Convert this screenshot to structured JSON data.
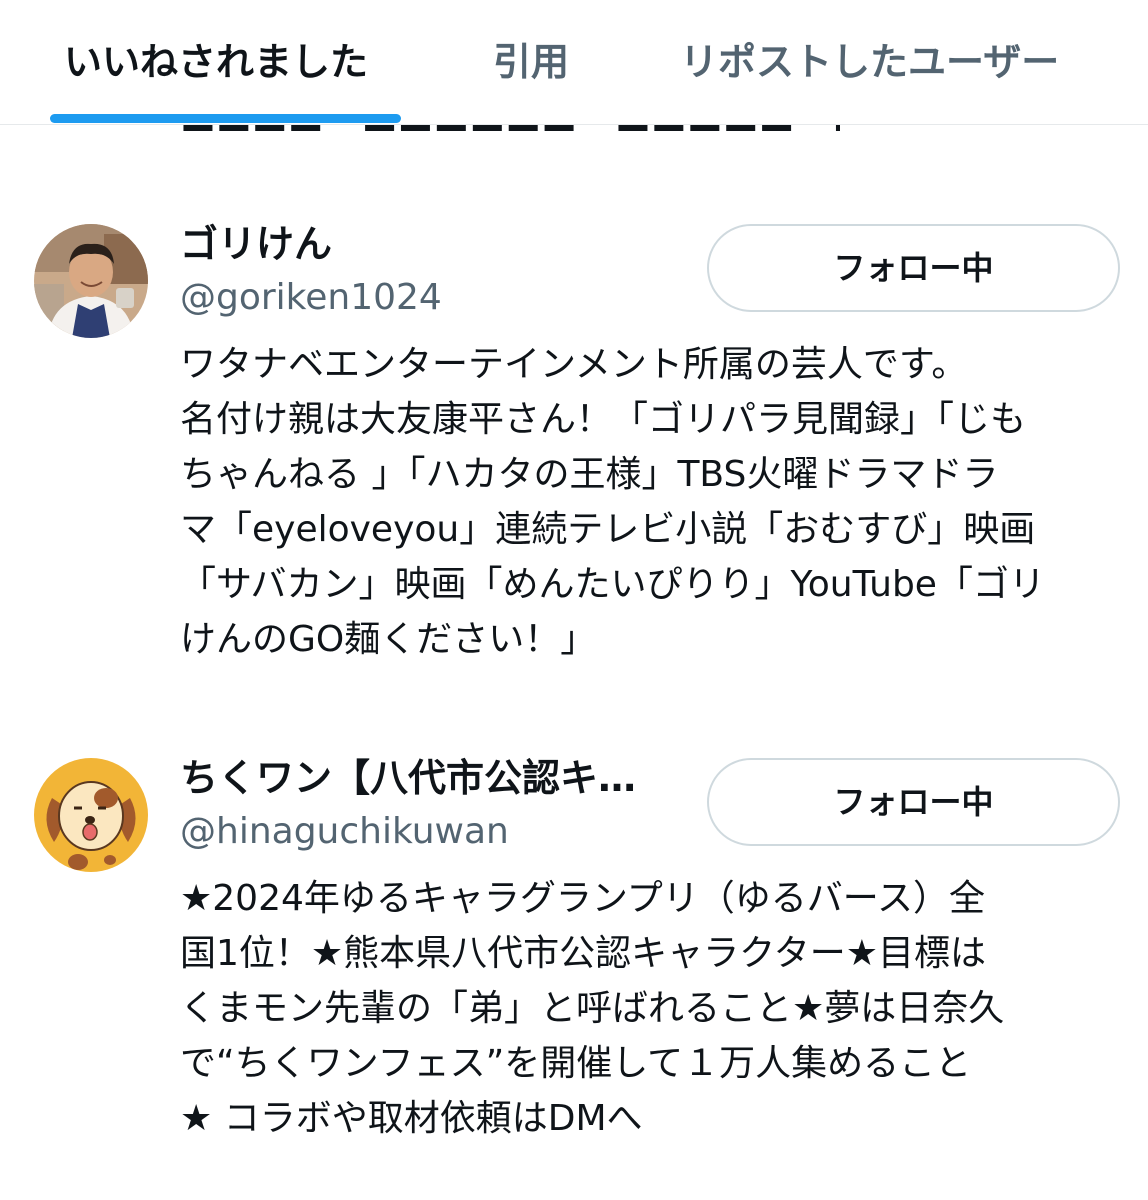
{
  "tabs": {
    "likes": "いいねされました",
    "quotes": "引用",
    "reposts": "リポストしたユーザー"
  },
  "clipped_text": "■■■■　■■■■■■　■■■■■　■",
  "users": [
    {
      "display_name": "ゴリけん",
      "handle": "@goriken1024",
      "follow_label": "フォロー中",
      "bio_lines": [
        "ワタナベエンターテインメント所属の芸人です。",
        "名付け親は大友康平さん！「ゴリパラ見聞録」「じも",
        "ちゃんねる 」「ハカタの王様」TBS火曜ドラマドラ",
        "マ「eyeloveyou」連続テレビ小説「おむすび」映画",
        "「サバカン」映画「めんたいぴりり」YouTube「ゴリ",
        "けんのGO麺ください！」"
      ]
    },
    {
      "display_name": "ちくワン【八代市公認キ…",
      "handle": "@hinaguchikuwan",
      "follow_label": "フォロー中",
      "bio_lines": [
        "★2024年ゆるキャラグランプリ（ゆるバース）全",
        "国1位！★熊本県八代市公認キャラクター★目標は",
        "くまモン先輩の「弟」と呼ばれること★夢は日奈久",
        "で“ちくワンフェス”を開催して１万人集めること",
        "★ コラボや取材依頼はDMへ"
      ]
    }
  ],
  "colors": {
    "accent": "#1d9bf0",
    "text_primary": "#0f1419",
    "text_secondary": "#536471",
    "border": "#cfd9de"
  }
}
